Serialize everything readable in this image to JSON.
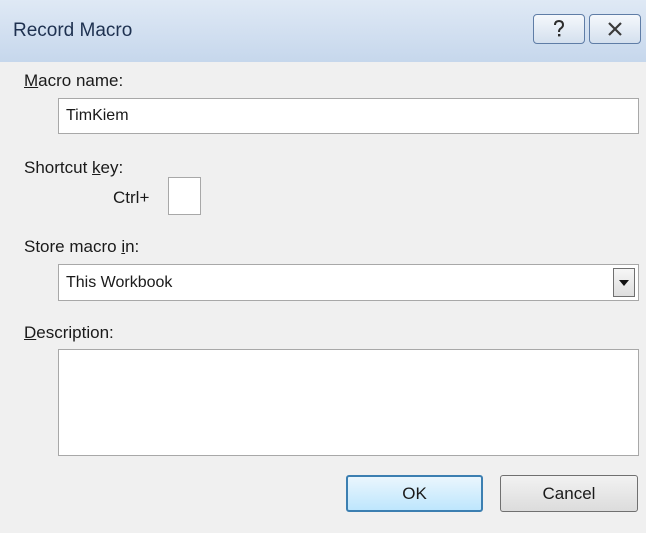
{
  "dialog": {
    "title": "Record Macro",
    "help_icon": "question-mark-icon",
    "close_icon": "close-icon"
  },
  "macro_name": {
    "label_prefix": "",
    "label_underlined": "M",
    "label_rest": "acro name:",
    "value": "TimKiem"
  },
  "shortcut_key": {
    "label_prefix": "Shortcut ",
    "label_underlined": "k",
    "label_rest": "ey:",
    "modifier": "Ctrl+",
    "value": ""
  },
  "store_macro": {
    "label_prefix": "Store macro ",
    "label_underlined": "i",
    "label_rest": "n:",
    "selected": "This Workbook",
    "dropdown_icon": "dropdown-arrow-icon"
  },
  "description": {
    "label_prefix": "",
    "label_underlined": "D",
    "label_rest": "escription:",
    "value": ""
  },
  "buttons": {
    "ok": "OK",
    "cancel": "Cancel"
  }
}
